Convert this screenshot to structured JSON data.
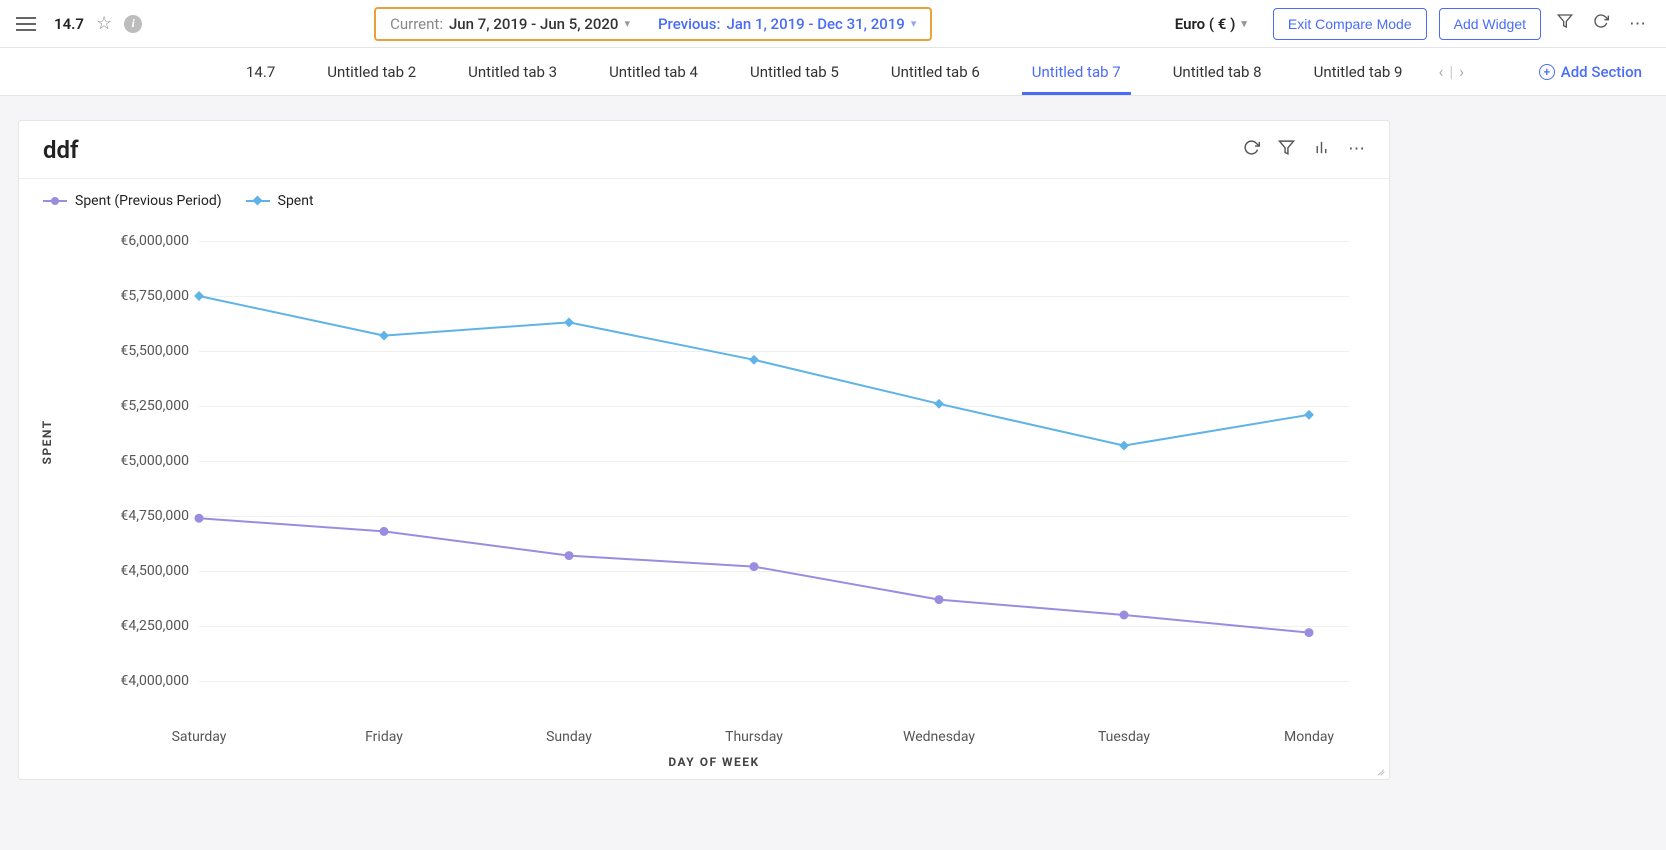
{
  "header": {
    "page_title": "14.7",
    "date_compare": {
      "current_label": "Current:",
      "current_range": "Jun 7, 2019 - Jun 5, 2020",
      "previous_label": "Previous:",
      "previous_range": "Jan 1, 2019 - Dec 31, 2019"
    },
    "currency": "Euro ( € )",
    "exit_compare_label": "Exit Compare Mode",
    "add_widget_label": "Add Widget"
  },
  "tabs": {
    "items": [
      {
        "label": "14.7",
        "active": false
      },
      {
        "label": "Untitled tab 2",
        "active": false
      },
      {
        "label": "Untitled tab 3",
        "active": false
      },
      {
        "label": "Untitled tab 4",
        "active": false
      },
      {
        "label": "Untitled tab 5",
        "active": false
      },
      {
        "label": "Untitled tab 6",
        "active": false
      },
      {
        "label": "Untitled tab 7",
        "active": true
      },
      {
        "label": "Untitled tab 8",
        "active": false
      },
      {
        "label": "Untitled tab 9",
        "active": false
      }
    ],
    "add_section_label": "Add Section"
  },
  "widget": {
    "title": "ddf",
    "legend": {
      "previous": "Spent (Previous Period)",
      "current": "Spent"
    },
    "ylabel": "SPENT",
    "xlabel": "DAY OF WEEK"
  },
  "chart_data": {
    "type": "line",
    "categories": [
      "Saturday",
      "Friday",
      "Sunday",
      "Thursday",
      "Wednesday",
      "Tuesday",
      "Monday"
    ],
    "series": [
      {
        "name": "Spent (Previous Period)",
        "color": "#9b8ce0",
        "values": [
          4740000,
          4680000,
          4570000,
          4520000,
          4370000,
          4300000,
          4220000
        ]
      },
      {
        "name": "Spent",
        "color": "#5fb3e6",
        "values": [
          5750000,
          5570000,
          5630000,
          5460000,
          5260000,
          5070000,
          5210000
        ]
      }
    ],
    "xlabel": "DAY OF WEEK",
    "ylabel": "SPENT",
    "ylim": [
      4000000,
      6000000
    ],
    "yticks": [
      4000000,
      4250000,
      4500000,
      4750000,
      5000000,
      5250000,
      5500000,
      5750000,
      6000000
    ],
    "ytick_labels": [
      "€4,000,000",
      "€4,250,000",
      "€4,500,000",
      "€4,750,000",
      "€5,000,000",
      "€5,250,000",
      "€5,500,000",
      "€5,750,000",
      "€6,000,000"
    ],
    "currency_prefix": "€"
  }
}
